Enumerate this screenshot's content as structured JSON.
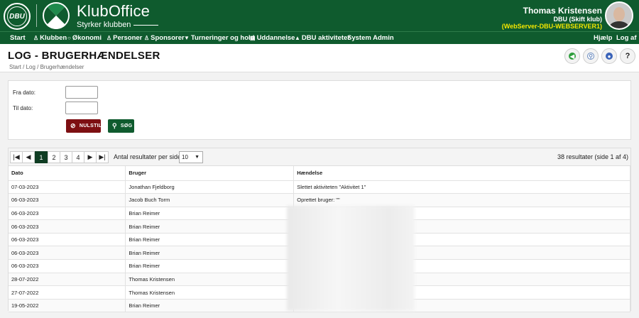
{
  "header": {
    "dbu_logo_text": "DBU",
    "brand_title": "KlubOffice",
    "brand_subtitle": "Styrker klubben",
    "user_name": "Thomas Kristensen",
    "user_club": "DBU (Skift klub)",
    "user_server": "(WebServer-DBU-WEBSERVER1)",
    "brand_color": "#0f5b2e"
  },
  "nav": {
    "items": [
      {
        "label": "Start",
        "icon": ""
      },
      {
        "label": "Klubben",
        "icon": "group-icon"
      },
      {
        "label": "Økonomi",
        "icon": "coin-icon"
      },
      {
        "label": "Personer",
        "icon": "person-icon"
      },
      {
        "label": "Sponsorer",
        "icon": "person-icon"
      },
      {
        "label": "Turneringer og hold",
        "icon": "trophy-icon"
      },
      {
        "label": "Uddannelse",
        "icon": "document-icon"
      },
      {
        "label": "DBU aktiviteter",
        "icon": "graduation-icon"
      },
      {
        "label": "System Admin",
        "icon": ""
      }
    ],
    "right_items": [
      {
        "label": "Hjælp"
      },
      {
        "label": "Log af"
      }
    ]
  },
  "page": {
    "title": "LOG - BRUGERHÆNDELSER",
    "breadcrumb": "Start / Log / Brugerhændelser"
  },
  "filters": {
    "from_label": "Fra dato:",
    "from_value": "",
    "to_label": "Til dato:",
    "to_value": "",
    "reset_label": "NULSTIL",
    "search_label": "SØG"
  },
  "pager": {
    "pages": [
      "1",
      "2",
      "3",
      "4"
    ],
    "active_page": "1",
    "per_page_label": "Antal resultater per side",
    "per_page_value": "10",
    "result_count": "38 resultater (side 1 af 4)"
  },
  "table": {
    "columns": [
      "Dato",
      "Bruger",
      "Hændelse"
    ],
    "rows": [
      [
        "07-03-2023",
        "Jonathan Fjeldborg",
        "Slettet aktiviteten \"Aktivitet 1\""
      ],
      [
        "06-03-2023",
        "Jacob Buch Torm",
        "Oprettet bruger: \"\""
      ],
      [
        "06-03-2023",
        "Brian Reimer",
        ""
      ],
      [
        "06-03-2023",
        "Brian Reimer",
        ""
      ],
      [
        "06-03-2023",
        "Brian Reimer",
        ""
      ],
      [
        "06-03-2023",
        "Brian Reimer",
        ""
      ],
      [
        "06-03-2023",
        "Brian Reimer",
        ""
      ],
      [
        "28-07-2022",
        "Thomas Kristensen",
        ""
      ],
      [
        "27-07-2022",
        "Thomas Kristensen",
        ""
      ],
      [
        "19-05-2022",
        "Brian Reimer",
        ""
      ]
    ]
  }
}
